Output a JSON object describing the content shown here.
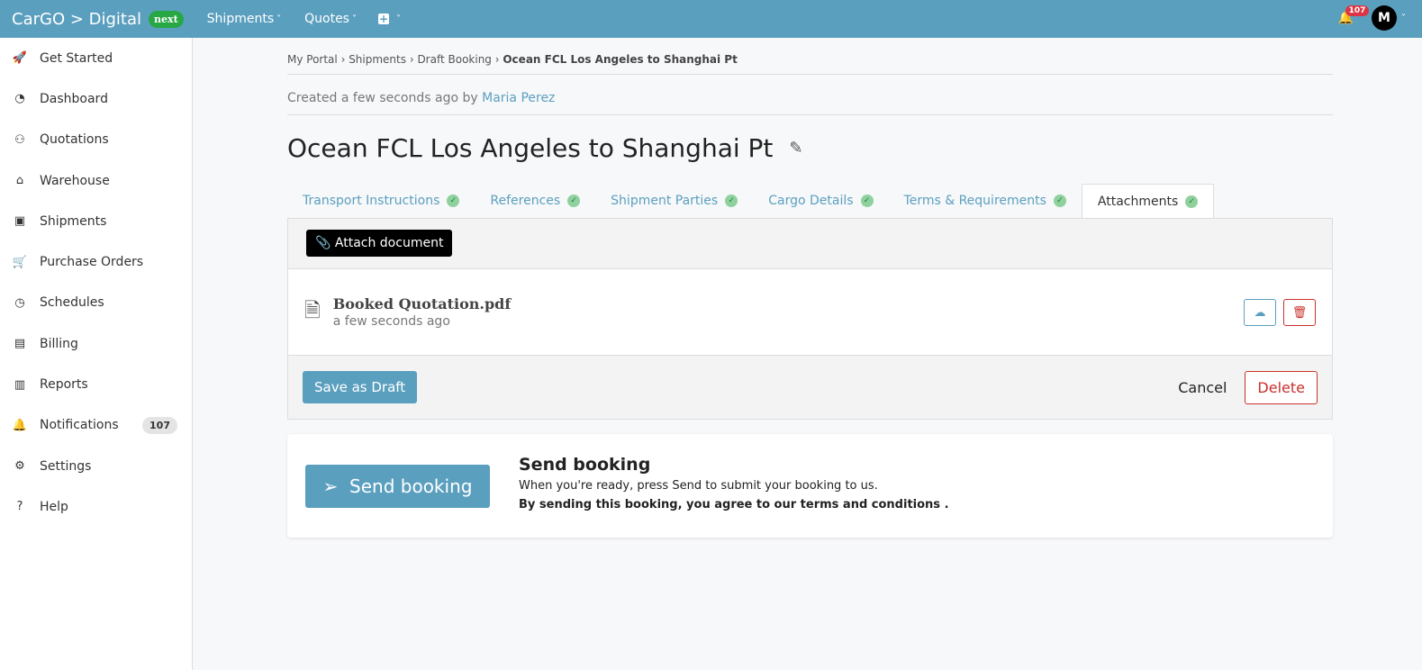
{
  "topbar": {
    "brand": "CarGO > Digital",
    "badge": "next",
    "nav": [
      "Shipments",
      "Quotes"
    ],
    "notifications": "107",
    "avatar": "M"
  },
  "sidebar": {
    "items": [
      {
        "label": "Get Started",
        "icon": "rocket-icon",
        "glyph": "🚀"
      },
      {
        "label": "Dashboard",
        "icon": "gauge-icon",
        "glyph": "◔"
      },
      {
        "label": "Quotations",
        "icon": "handshake-icon",
        "glyph": "⚇"
      },
      {
        "label": "Warehouse",
        "icon": "warehouse-icon",
        "glyph": "⌂"
      },
      {
        "label": "Shipments",
        "icon": "box-icon",
        "glyph": "▣"
      },
      {
        "label": "Purchase Orders",
        "icon": "cart-icon",
        "glyph": "🛒"
      },
      {
        "label": "Schedules",
        "icon": "clock-icon",
        "glyph": "◷"
      },
      {
        "label": "Billing",
        "icon": "billing-icon",
        "glyph": "▤"
      },
      {
        "label": "Reports",
        "icon": "chart-icon",
        "glyph": "▥"
      },
      {
        "label": "Notifications",
        "icon": "bell-icon",
        "glyph": "🔔",
        "badge": "107"
      },
      {
        "label": "Settings",
        "icon": "gear-icon",
        "glyph": "⚙"
      },
      {
        "label": "Help",
        "icon": "help-icon",
        "glyph": "?"
      }
    ]
  },
  "breadcrumb": [
    "My Portal",
    "Shipments",
    "Draft Booking",
    "Ocean FCL Los Angeles to Shanghai Pt"
  ],
  "created": {
    "text": "Created a few seconds ago by",
    "user": "Maria Perez"
  },
  "title": "Ocean FCL Los Angeles to Shanghai Pt",
  "tabs": [
    "Transport Instructions",
    "References",
    "Shipment Parties",
    "Cargo Details",
    "Terms & Requirements",
    "Attachments"
  ],
  "attach_label": "Attach document",
  "file": {
    "name": "Booked Quotation.pdf",
    "time": "a few seconds ago"
  },
  "footer": {
    "save": "Save as Draft",
    "cancel": "Cancel",
    "delete": "Delete"
  },
  "send": {
    "button": "Send booking",
    "title": "Send booking",
    "desc": "When you're ready, press Send to submit your booking to us.",
    "terms": "By sending this booking, you agree to our terms and conditions ."
  },
  "colors": {
    "primary": "#5b9fbf",
    "danger": "#c9302c",
    "success": "#28a745"
  }
}
